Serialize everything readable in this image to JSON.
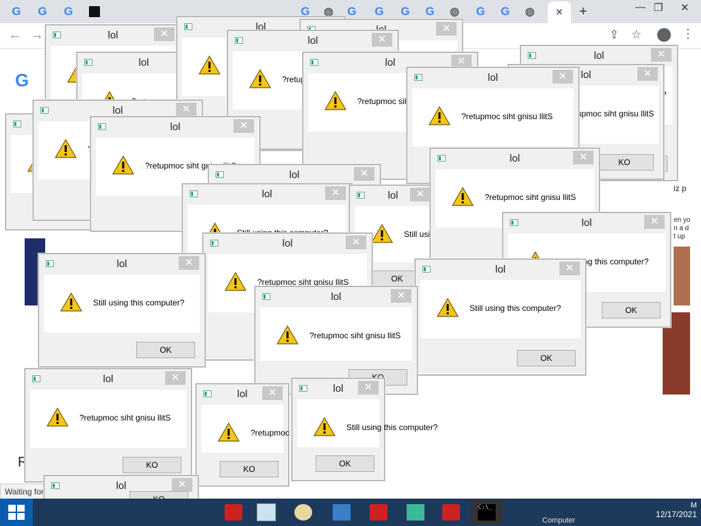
{
  "browser": {
    "tab_favicons": [
      "G",
      "G",
      "G",
      "ticket",
      "G",
      "globe",
      "G",
      "G",
      "G",
      "G",
      "G",
      "globe",
      "G",
      "G",
      "globe",
      "G"
    ],
    "new_tab": "+",
    "controls": {
      "minimize": "—",
      "maximize": "❐",
      "close": "✕"
    },
    "back": "←",
    "forward": "→",
    "status_text": "Waiting for c"
  },
  "page_fragments": {
    "google_partial": "G",
    "pz_text": "iz p",
    "side_text_1": "en yo",
    "side_text_2": "n a d",
    "side_text_3": "t up",
    "letter_r": "R"
  },
  "dialog_strings": {
    "title": "lol",
    "message_normal": "Still using this computer?",
    "message_reversed": "?retupmoc siht gnisu llitS",
    "ok_normal": "OK",
    "ok_reversed": "KO",
    "close": "✕"
  },
  "dialogs": [
    {
      "title": "lol",
      "message": "Still using this computer?",
      "button": "OK"
    },
    {
      "title": "lol",
      "message": "?retupmoc siht gnisu llitS",
      "button": "KO"
    },
    {
      "title": "lol",
      "message": "?retupmoc siht gnisu llitS",
      "button": "KO"
    },
    {
      "title": "lol",
      "message": "?retupmoc siht gnisu llitS",
      "button": "KO"
    },
    {
      "title": "lol",
      "message": "?retupmoc siht gnisu llitS",
      "button": "KO"
    },
    {
      "title": "lol",
      "message": "Still using this computer?",
      "button": "OK"
    },
    {
      "title": "lol",
      "message": "?retupmoc siht gnisu llitS",
      "button": "KO"
    },
    {
      "title": "lol",
      "message": "?retupmoc siht gnisu llitS",
      "button": "KO"
    },
    {
      "title": "lol",
      "message": "?retupmoc siht gnisu llitS",
      "button": "KO"
    },
    {
      "title": "lol",
      "message": "?retupmoc siht gnisu llitS",
      "button": "KO"
    },
    {
      "title": "lol",
      "message": "?retupmoc siht gnisu llitS",
      "button": "KO"
    },
    {
      "title": "lol",
      "message": "?retupmoc siht gnisu llitS",
      "button": "KO"
    },
    {
      "title": "lol",
      "message": "Still using this computer?",
      "button": "OK"
    },
    {
      "title": "lol",
      "message": "Still using this computer?",
      "button": "OK"
    },
    {
      "title": "lol",
      "message": "?retupmoc siht gnisu llitS",
      "button": "KO"
    },
    {
      "title": "lol",
      "message": "?retupmoc siht gnisu llitS",
      "button": "KO"
    },
    {
      "title": "lol",
      "message": "Still using this computer?",
      "button": "OK"
    },
    {
      "title": "lol",
      "message": "?retupmoc siht gnisu llitS",
      "button": "KO"
    },
    {
      "title": "lol",
      "message": "Still using this computer?",
      "button": "OK"
    }
  ],
  "taskbar": {
    "items": [
      "toolbox",
      "calculator",
      "paint",
      "control-panel",
      "toolbox",
      "cube",
      "toolbox",
      "cmd"
    ],
    "cmd_text": "C:\\_",
    "tray_time": "M",
    "tray_date": "12/17/2021",
    "computer_label": "Computer"
  }
}
